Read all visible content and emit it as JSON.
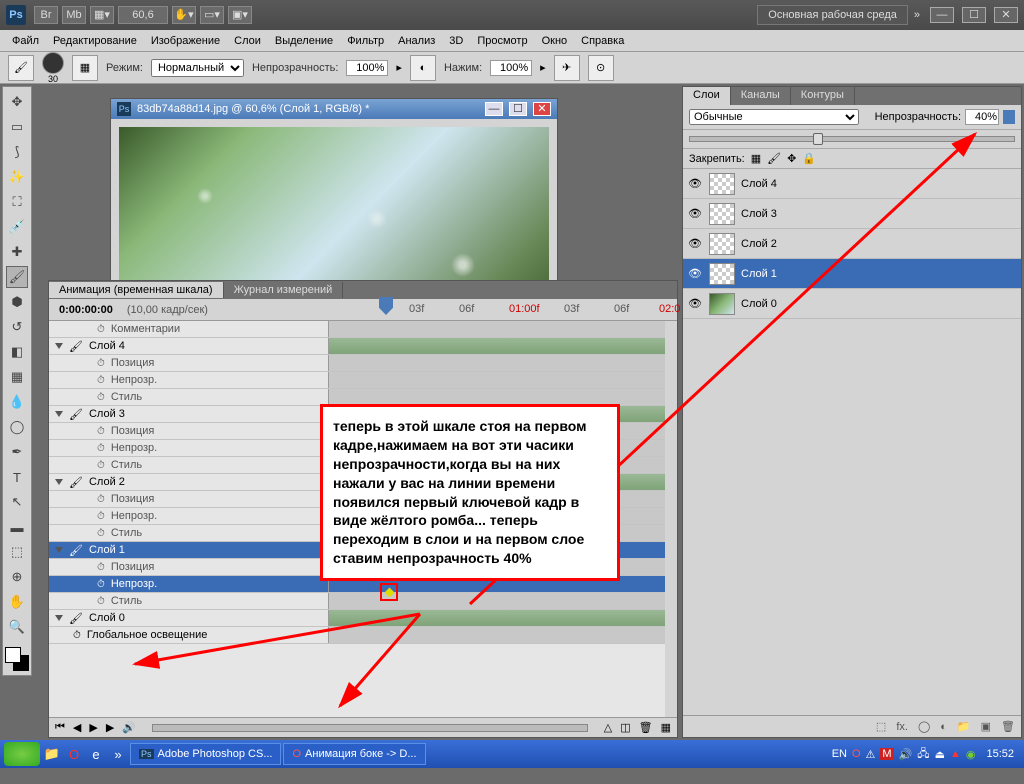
{
  "titlebar": {
    "zoom_field": "60,6",
    "workspace_label": "Основная рабочая среда"
  },
  "menubar": [
    "Файл",
    "Редактирование",
    "Изображение",
    "Слои",
    "Выделение",
    "Фильтр",
    "Анализ",
    "3D",
    "Просмотр",
    "Окно",
    "Справка"
  ],
  "optbar": {
    "brush_size": "30",
    "mode_label": "Режим:",
    "mode_value": "Нормальный",
    "opacity_label": "Непрозрачность:",
    "opacity_value": "100%",
    "flow_label": "Нажим:",
    "flow_value": "100%"
  },
  "doc": {
    "title": "83db74a88d14.jpg @ 60,6% (Слой 1, RGB/8) *"
  },
  "timeline": {
    "tabs": [
      "Анимация (временная шкала)",
      "Журнал измерений"
    ],
    "timecode": "0:00:00:00",
    "fps": "(10,00 кадр/сек)",
    "rulers": [
      "03f",
      "06f",
      "01:00f",
      "03f",
      "06f",
      "02:0"
    ],
    "rows": [
      {
        "type": "prop",
        "label": "Комментарии",
        "lvl": 2
      },
      {
        "type": "layer",
        "label": "Слой 4"
      },
      {
        "type": "prop",
        "label": "Позиция",
        "lvl": 2
      },
      {
        "type": "prop",
        "label": "Непрозр.",
        "lvl": 2
      },
      {
        "type": "prop",
        "label": "Стиль",
        "lvl": 2
      },
      {
        "type": "layer",
        "label": "Слой 3"
      },
      {
        "type": "prop",
        "label": "Позиция",
        "lvl": 2
      },
      {
        "type": "prop",
        "label": "Непрозр.",
        "lvl": 2
      },
      {
        "type": "prop",
        "label": "Стиль",
        "lvl": 2
      },
      {
        "type": "layer",
        "label": "Слой 2"
      },
      {
        "type": "prop",
        "label": "Позиция",
        "lvl": 2
      },
      {
        "type": "prop",
        "label": "Непрозр.",
        "lvl": 2
      },
      {
        "type": "prop",
        "label": "Стиль",
        "lvl": 2
      },
      {
        "type": "layer",
        "label": "Слой 1",
        "sel": true
      },
      {
        "type": "prop",
        "label": "Позиция",
        "lvl": 2
      },
      {
        "type": "prop",
        "label": "Непрозр.",
        "lvl": 2,
        "sel": true
      },
      {
        "type": "prop",
        "label": "Стиль",
        "lvl": 2
      },
      {
        "type": "layer",
        "label": "Слой 0"
      },
      {
        "type": "prop",
        "label": "Глобальное освещение",
        "lvl": 1
      }
    ]
  },
  "layerspanel": {
    "tabs": [
      "Слои",
      "Каналы",
      "Контуры"
    ],
    "blend_value": "Обычные",
    "opacity_label": "Непрозрачность:",
    "opacity_value": "40%",
    "lock_label": "Закрепить:",
    "layers": [
      {
        "name": "Слой 4"
      },
      {
        "name": "Слой 3"
      },
      {
        "name": "Слой 2"
      },
      {
        "name": "Слой 1",
        "sel": true
      },
      {
        "name": "Слой 0",
        "img": true
      }
    ]
  },
  "callout": "теперь в этой шкале стоя на первом кадре,нажимаем на вот эти часики непрозрачности,когда вы на них нажали у вас на линии времени появился первый ключевой кадр в виде жёлтого ромба... теперь переходим в слои и на первом слое ставим непрозрачность  40%",
  "taskbar": {
    "apps": [
      "Adobe Photoshop CS...",
      "Анимация боке -> D..."
    ],
    "lang": "EN",
    "time": "15:52"
  }
}
